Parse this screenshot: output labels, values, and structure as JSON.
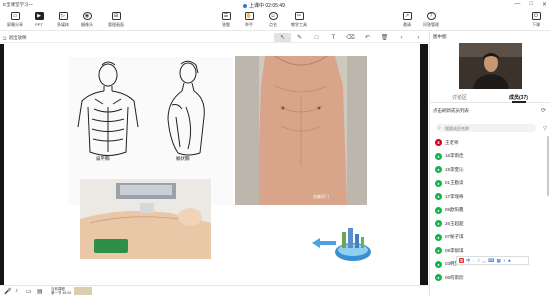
{
  "app": {
    "title": "E宝课堂学习一",
    "class_status": "上课中 02:05:49",
    "window_controls": [
      "—",
      "□",
      "✕"
    ]
  },
  "toolbar": {
    "left": [
      {
        "label": "屏幕分享",
        "icon": "screen-share-icon"
      },
      {
        "label": "PPT",
        "icon": "ppt-icon",
        "active": true
      },
      {
        "label": "多媒体",
        "icon": "media-icon"
      },
      {
        "label": "摄像头",
        "icon": "camera-icon"
      },
      {
        "label": "管理画面",
        "icon": "layout-icon"
      }
    ],
    "center": [
      {
        "label": "答题",
        "icon": "answer-icon"
      },
      {
        "label": "举手",
        "icon": "hand-icon"
      },
      {
        "label": "点名",
        "icon": "rollcall-icon"
      },
      {
        "label": "教学工具",
        "icon": "tools-icon"
      }
    ],
    "right": [
      {
        "label": "邀请",
        "icon": "invite-icon"
      },
      {
        "label": "问答管理",
        "icon": "qa-icon"
      },
      {
        "label": "下课",
        "icon": "end-class-icon"
      }
    ]
  },
  "subbar": {
    "exit_label": "退出放映",
    "tools": [
      "↖",
      "✎",
      "□",
      "T",
      "⌫",
      "↶",
      "🗑",
      "‹",
      "›"
    ]
  },
  "slide": {
    "caption_left": "扁平胸",
    "caption_right": "桶状胸",
    "photo_watermark": "芝麻开门"
  },
  "bottombar": {
    "icons": [
      "mic-icon",
      "music-icon",
      "chat-icon",
      "folder-icon"
    ],
    "progress_line1": "当前课程",
    "progress_line2": "第一节 45:00"
  },
  "right_panel": {
    "video_header": "图中图",
    "tabs": [
      {
        "label": "讨论区",
        "active": false
      },
      {
        "label": "成员(37)",
        "active": true
      }
    ],
    "member_title": "点击刷新成员列表",
    "search_placeholder": "搜索成员名称",
    "members": [
      {
        "name": "王老师",
        "host": true
      },
      {
        "name": "16李雨佳"
      },
      {
        "name": "19李雯沁"
      },
      {
        "name": "01王勤读"
      },
      {
        "name": "17李瑞奇"
      },
      {
        "name": "05欧阳鑫"
      },
      {
        "name": "26王超超"
      },
      {
        "name": "07秘子琪"
      },
      {
        "name": "09李硕琪"
      },
      {
        "name": "03韩梦琳"
      },
      {
        "name": "06何雨欣"
      }
    ],
    "ime": [
      "S",
      "中",
      "·",
      "☽",
      "◡",
      "⌨",
      "▦",
      "♀",
      "♠"
    ]
  }
}
